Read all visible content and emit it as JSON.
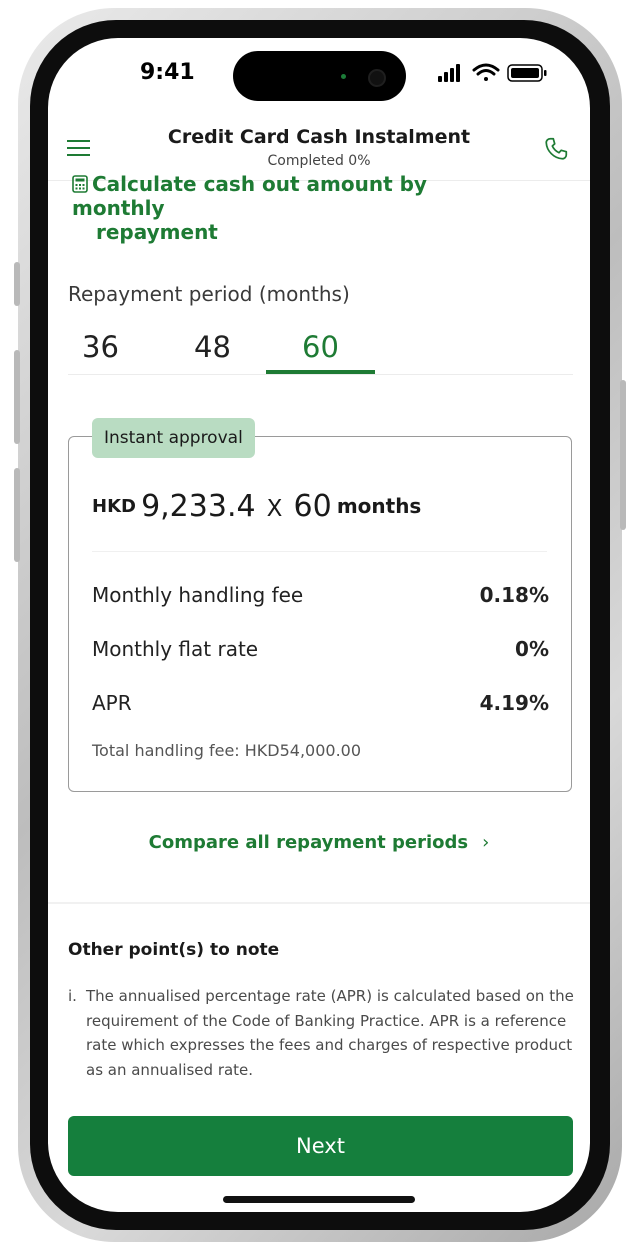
{
  "status_bar": {
    "time": "9:41"
  },
  "header": {
    "title": "Credit Card Cash Instalment",
    "subtitle": "Completed 0%"
  },
  "calculator_link": {
    "line1": "Calculate cash out amount by monthly",
    "line2": "repayment"
  },
  "repayment": {
    "label": "Repayment period (months)",
    "options": [
      "36",
      "48",
      "60"
    ],
    "selected": "60"
  },
  "offer_card": {
    "badge": "Instant approval",
    "currency": "HKD",
    "monthly_amount": "9,233.4",
    "multiplier": "X",
    "months": "60",
    "months_label": "months",
    "rows": [
      {
        "label": "Monthly handling fee",
        "value": "0.18%"
      },
      {
        "label": "Monthly flat rate",
        "value": "0%"
      },
      {
        "label": "APR",
        "value": "4.19%"
      }
    ],
    "total_fee": "Total handling fee: HKD54,000.00"
  },
  "compare_link": {
    "label": "Compare all repayment periods",
    "chevron": "›"
  },
  "notes": {
    "title": "Other point(s) to note",
    "items": [
      {
        "marker": "i.",
        "text": "The annualised percentage rate (APR) is calculated based on the requirement of the Code of Banking Practice. APR is a reference rate which expresses the fees and charges of respective product as an annualised rate."
      }
    ]
  },
  "footer": {
    "next_label": "Next"
  },
  "colors": {
    "accent": "#1e7b34",
    "button": "#157f3d",
    "badge": "#b9dcc2"
  },
  "icons": [
    "menu-icon",
    "phone-icon",
    "calculator-icon",
    "signal-icon",
    "wifi-icon",
    "battery-icon",
    "chevron-right-icon"
  ]
}
